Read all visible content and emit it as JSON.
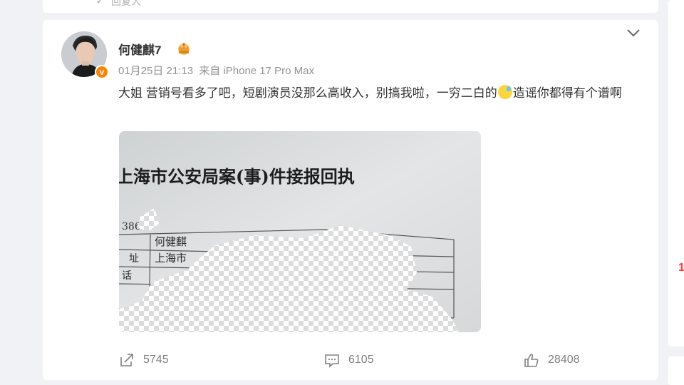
{
  "prev_card": {
    "label": "回复人"
  },
  "post": {
    "username": "何健麒7",
    "date": "01月25日 21:13",
    "source": "来自 iPhone 17 Pro Max",
    "text_part1": "大姐 营销号看多了吧，短剧演员没那么高收入，别搞我啦，一穷二白的",
    "text_part2": "造谣你都得有个谱啊",
    "emoji_name": "sweat-emoji",
    "image": {
      "doc_title": "上海市公安局案(事)件接报回执",
      "doc_number": "386",
      "name_field": "何健麒",
      "address_label": "址",
      "address_value": "上海市",
      "phone_label": "话"
    }
  },
  "actions": {
    "share_count": "5745",
    "comment_count": "6105",
    "like_count": "28408"
  },
  "colors": {
    "badge": "#ff8200",
    "text": "#333333",
    "meta": "#939393",
    "icon": "#808080"
  }
}
